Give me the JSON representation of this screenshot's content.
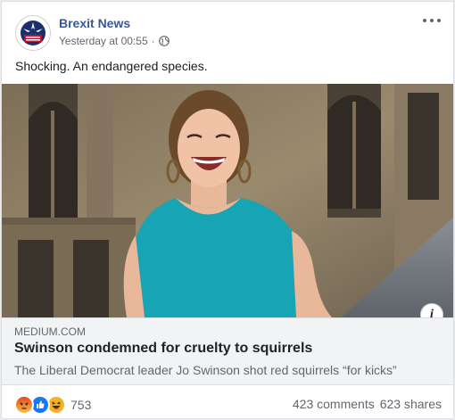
{
  "post": {
    "page_name": "Brexit News",
    "timestamp": "Yesterday at 00:55",
    "separator": "·",
    "privacy_icon": "globe-icon",
    "text": "Shocking. An endangered species."
  },
  "link": {
    "domain": "MEDIUM.COM",
    "headline": "Swinson condemned for cruelty to squirrels",
    "description": "The Liberal Democrat leader Jo Swinson shot red squirrels “for kicks”"
  },
  "footer": {
    "reaction_icons": [
      "angry-icon",
      "like-icon",
      "haha-icon"
    ],
    "reaction_count": "753",
    "comments": "423 comments",
    "shares": "623 shares"
  },
  "colors": {
    "link_blue": "#385898",
    "secondary_text": "#606770",
    "dress_teal": "#17a4b4",
    "stone": "#8a7a60"
  }
}
